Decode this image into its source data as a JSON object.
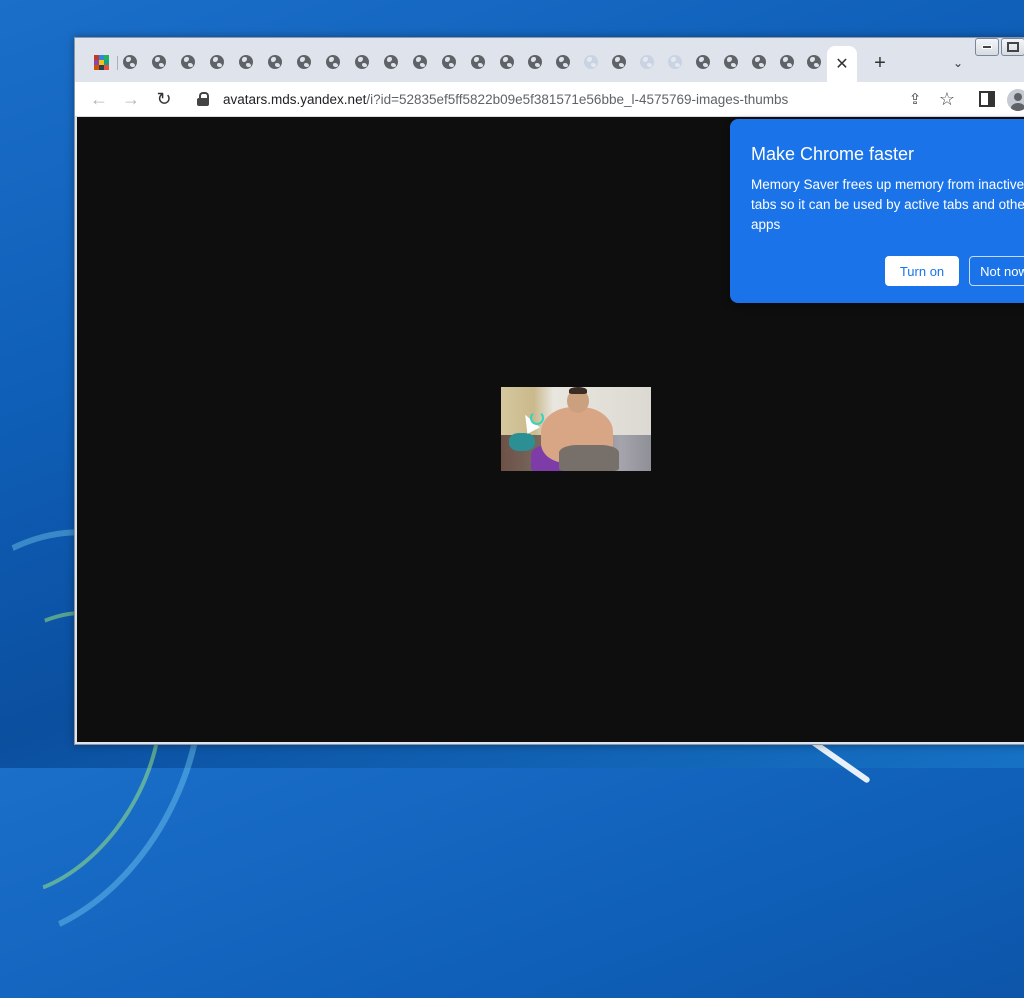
{
  "browser": {
    "tabs": {
      "first_icon": "winrar-archive-icon",
      "other_icon": "globe-icon",
      "count_globe": 25,
      "active_close_label": "✕"
    },
    "new_tab_label": "+",
    "tab_search_label": "⌄",
    "toolbar": {
      "back_icon": "←",
      "forward_icon": "→",
      "reload_icon": "↻",
      "url_host": "avatars.mds.yandex.net",
      "url_path": "/i?id=52835ef5ff5822b09e5f381571e56bbe_l-4575769-images-thumbs",
      "share_icon": "⇪",
      "star_icon": "☆"
    }
  },
  "memory_saver_bubble": {
    "title": "Make Chrome faster",
    "body": "Memory Saver frees up memory from inactive tabs so it can be used by active tabs and other apps",
    "turn_on_label": "Turn on",
    "not_now_label": "Not now"
  },
  "colors": {
    "bubble_bg": "#1a73e8",
    "viewport_bg": "#0e0e0e"
  }
}
